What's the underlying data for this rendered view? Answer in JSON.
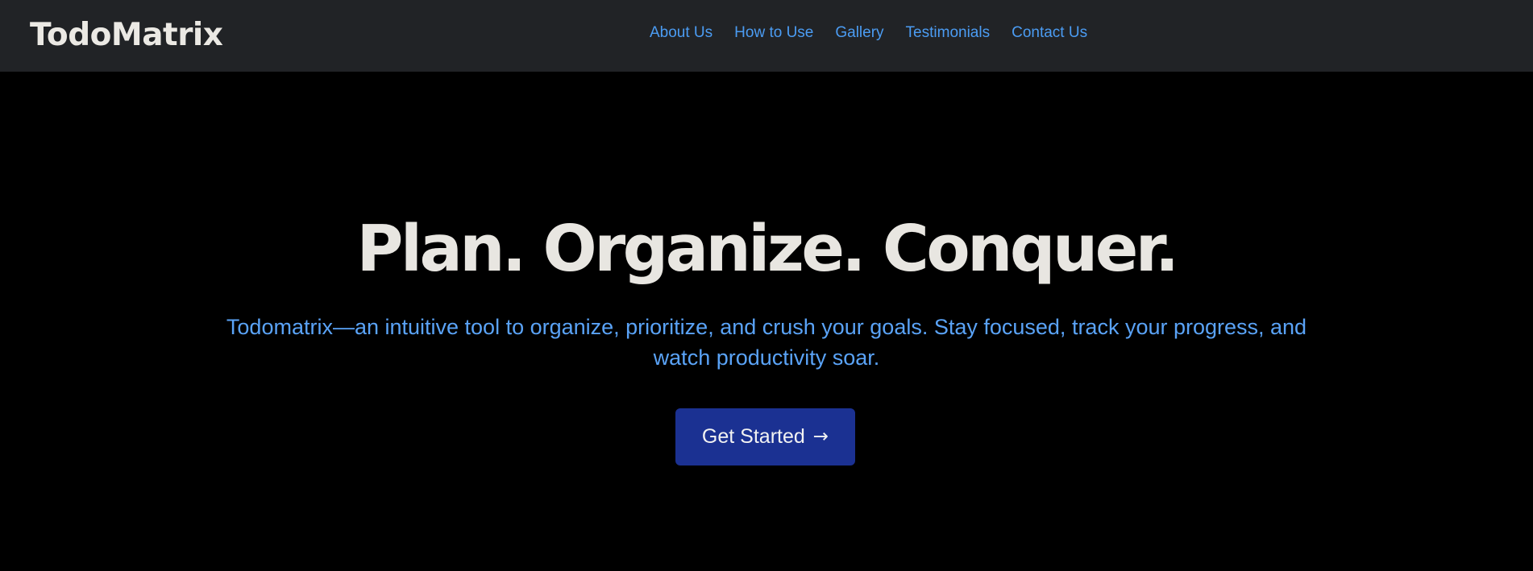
{
  "header": {
    "brand": "TodoMatrix",
    "nav": [
      {
        "label": "About Us"
      },
      {
        "label": "How to Use"
      },
      {
        "label": "Gallery"
      },
      {
        "label": "Testimonials"
      },
      {
        "label": "Contact Us"
      }
    ]
  },
  "hero": {
    "title": "Plan. Organize. Conquer.",
    "subtitle": "Todomatrix—an intuitive tool to organize, prioritize, and crush your goals. Stay focused, track your progress, and watch productivity soar.",
    "cta_label": "Get Started",
    "cta_icon": "arrow-right-icon",
    "cta_icon_glyph": "→"
  },
  "colors": {
    "navbar_bg": "#212326",
    "page_bg": "#000000",
    "link": "#4b9cf3",
    "subtitle": "#5aa3f7",
    "button_bg": "#1b3192",
    "title": "#e8e6e1"
  }
}
